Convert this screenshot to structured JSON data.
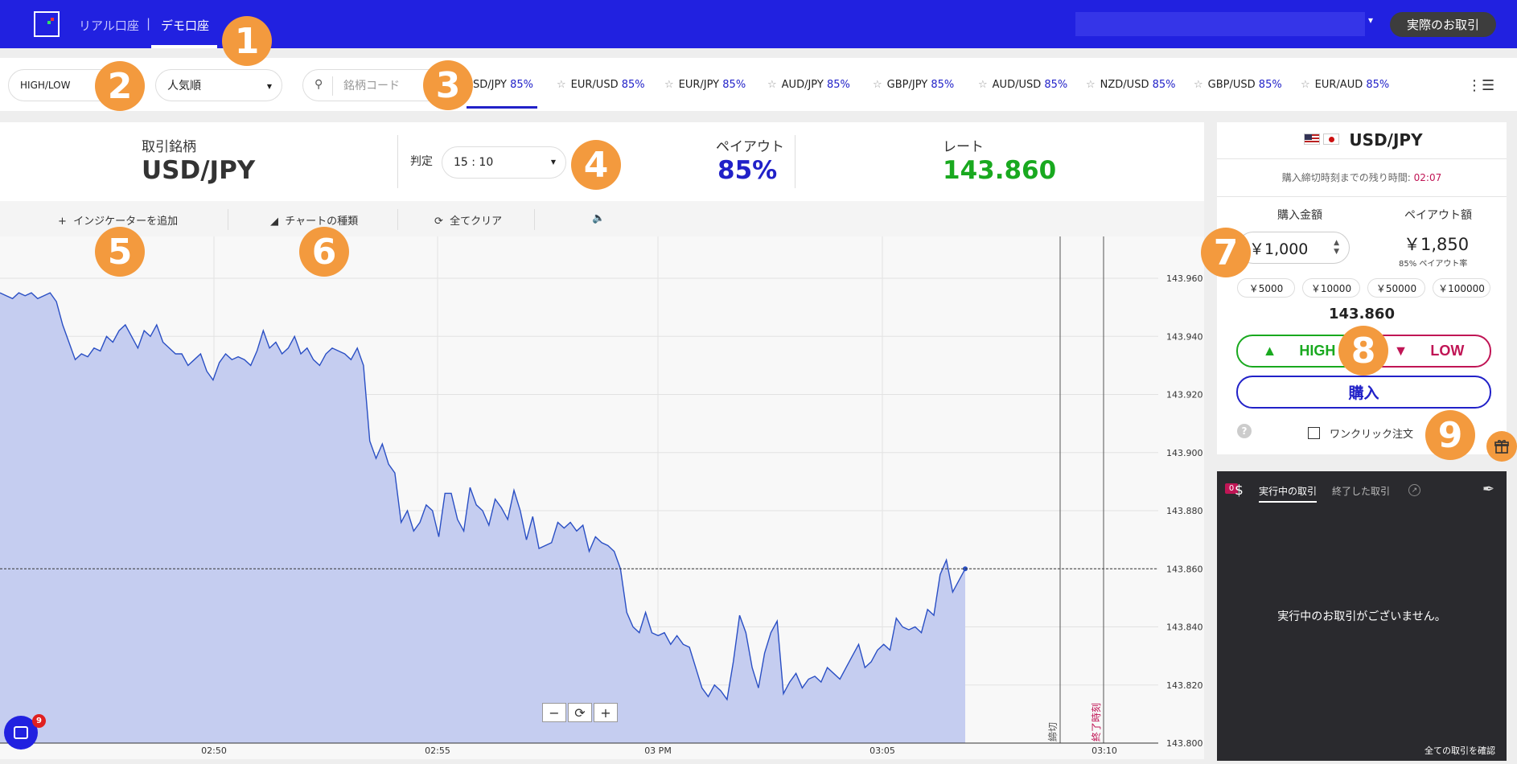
{
  "topbar": {
    "real_account_tab": "リアル口座",
    "separator": "|",
    "demo_account_tab": "デモ口座",
    "real_trade_button": "実際のお取引"
  },
  "annotations": [
    "1",
    "2",
    "3",
    "4",
    "5",
    "6",
    "7",
    "8",
    "9"
  ],
  "filter": {
    "option_type": "HIGH/LOW",
    "sort_order": "人気順",
    "search_placeholder": "銘柄コード",
    "pairs": [
      {
        "name": "USD/JPY",
        "payout": "85%"
      },
      {
        "name": "EUR/USD",
        "payout": "85%"
      },
      {
        "name": "EUR/JPY",
        "payout": "85%"
      },
      {
        "name": "AUD/JPY",
        "payout": "85%"
      },
      {
        "name": "GBP/JPY",
        "payout": "85%"
      },
      {
        "name": "AUD/USD",
        "payout": "85%"
      },
      {
        "name": "NZD/USD",
        "payout": "85%"
      },
      {
        "name": "GBP/USD",
        "payout": "85%"
      },
      {
        "name": "EUR/AUD",
        "payout": "85%"
      }
    ],
    "visible_first_pair": "SD/JPY"
  },
  "info": {
    "symbol_label": "取引銘柄",
    "symbol": "USD/JPY",
    "expiry_label": "判定",
    "expiry_value": "15 : 10",
    "payout_label": "ペイアウト",
    "payout": "85%",
    "rate_label": "レート",
    "rate": "143.860"
  },
  "toolbar": {
    "add_indicator": "インジケーターを追加",
    "chart_type": "チャートの種類",
    "clear_all": "全てクリア"
  },
  "chart_data": {
    "type": "area",
    "ylim": [
      143.8,
      143.965
    ],
    "y_ticks": [
      "143.960",
      "143.940",
      "143.920",
      "143.900",
      "143.880",
      "143.860",
      "143.840",
      "143.820",
      "143.800"
    ],
    "x_ticks": [
      "02:50",
      "02:55",
      "03 PM",
      "03:05",
      "03:10"
    ],
    "current_price": 143.86,
    "markers": [
      "締切",
      "終了時刻"
    ],
    "series": [
      {
        "values": [
          143.955,
          143.954,
          143.953,
          143.955,
          143.954,
          143.955,
          143.953,
          143.954,
          143.955,
          143.952,
          143.944,
          143.938,
          143.932,
          143.934,
          143.933,
          143.936,
          143.935,
          143.94,
          143.938,
          143.942,
          143.944,
          143.94,
          143.936,
          143.942,
          143.94,
          143.944,
          143.938,
          143.936,
          143.934,
          143.934,
          143.93,
          143.932,
          143.934,
          143.928,
          143.925,
          143.931,
          143.934,
          143.932,
          143.933,
          143.932,
          143.93,
          143.935,
          143.942,
          143.936,
          143.938,
          143.934,
          143.936,
          143.94,
          143.934,
          143.936,
          143.932,
          143.93,
          143.934,
          143.936,
          143.935,
          143.934,
          143.932,
          143.936,
          143.93,
          143.904,
          143.898,
          143.903,
          143.896,
          143.893,
          143.876,
          143.88,
          143.873,
          143.876,
          143.882,
          143.88,
          143.871,
          143.886,
          143.886,
          143.877,
          143.873,
          143.888,
          143.882,
          143.88,
          143.875,
          143.884,
          143.881,
          143.877,
          143.887,
          143.88,
          143.87,
          143.878,
          143.867,
          143.868,
          143.869,
          143.876,
          143.874,
          143.876,
          143.873,
          143.875,
          143.866,
          143.871,
          143.869,
          143.868,
          143.866,
          143.86,
          143.845,
          143.84,
          143.838,
          143.845,
          143.838,
          143.837,
          143.838,
          143.834,
          143.837,
          143.834,
          143.833,
          143.826,
          143.819,
          143.816,
          143.82,
          143.818,
          143.815,
          143.828,
          143.844,
          143.838,
          143.826,
          143.819,
          143.831,
          143.838,
          143.842,
          143.817,
          143.821,
          143.824,
          143.819,
          143.822,
          143.823,
          143.821,
          143.826,
          143.824,
          143.822,
          143.826,
          143.83,
          143.834,
          143.826,
          143.828,
          143.832,
          143.834,
          143.832,
          143.843,
          143.84,
          143.839,
          143.84,
          143.838,
          143.846,
          143.844,
          143.858,
          143.863,
          143.852,
          143.856,
          143.86
        ]
      }
    ]
  },
  "trade_panel": {
    "symbol": "USD/JPY",
    "remaining_label": "購入締切時刻までの残り時間:",
    "remaining_time": "02:07",
    "amount_label": "購入金額",
    "payout_amount_label": "ペイアウト額",
    "amount": "￥1,000",
    "payout_amount": "￥1,850",
    "payout_rate": "85% ペイアウト率",
    "quick_amounts": [
      "￥5000",
      "￥10000",
      "￥50000",
      "￥100000"
    ],
    "current_rate": "143.860",
    "high": "HIGH",
    "low": "LOW",
    "buy": "購入",
    "help": "?",
    "one_click": "ワンクリック注文"
  },
  "trades": {
    "count": "0",
    "active_tab": "実行中の取引",
    "closed_tab": "終了した取引",
    "empty_message": "実行中のお取引がございません。",
    "view_all": "全ての取引を確認"
  },
  "chat": {
    "badge": "9"
  }
}
